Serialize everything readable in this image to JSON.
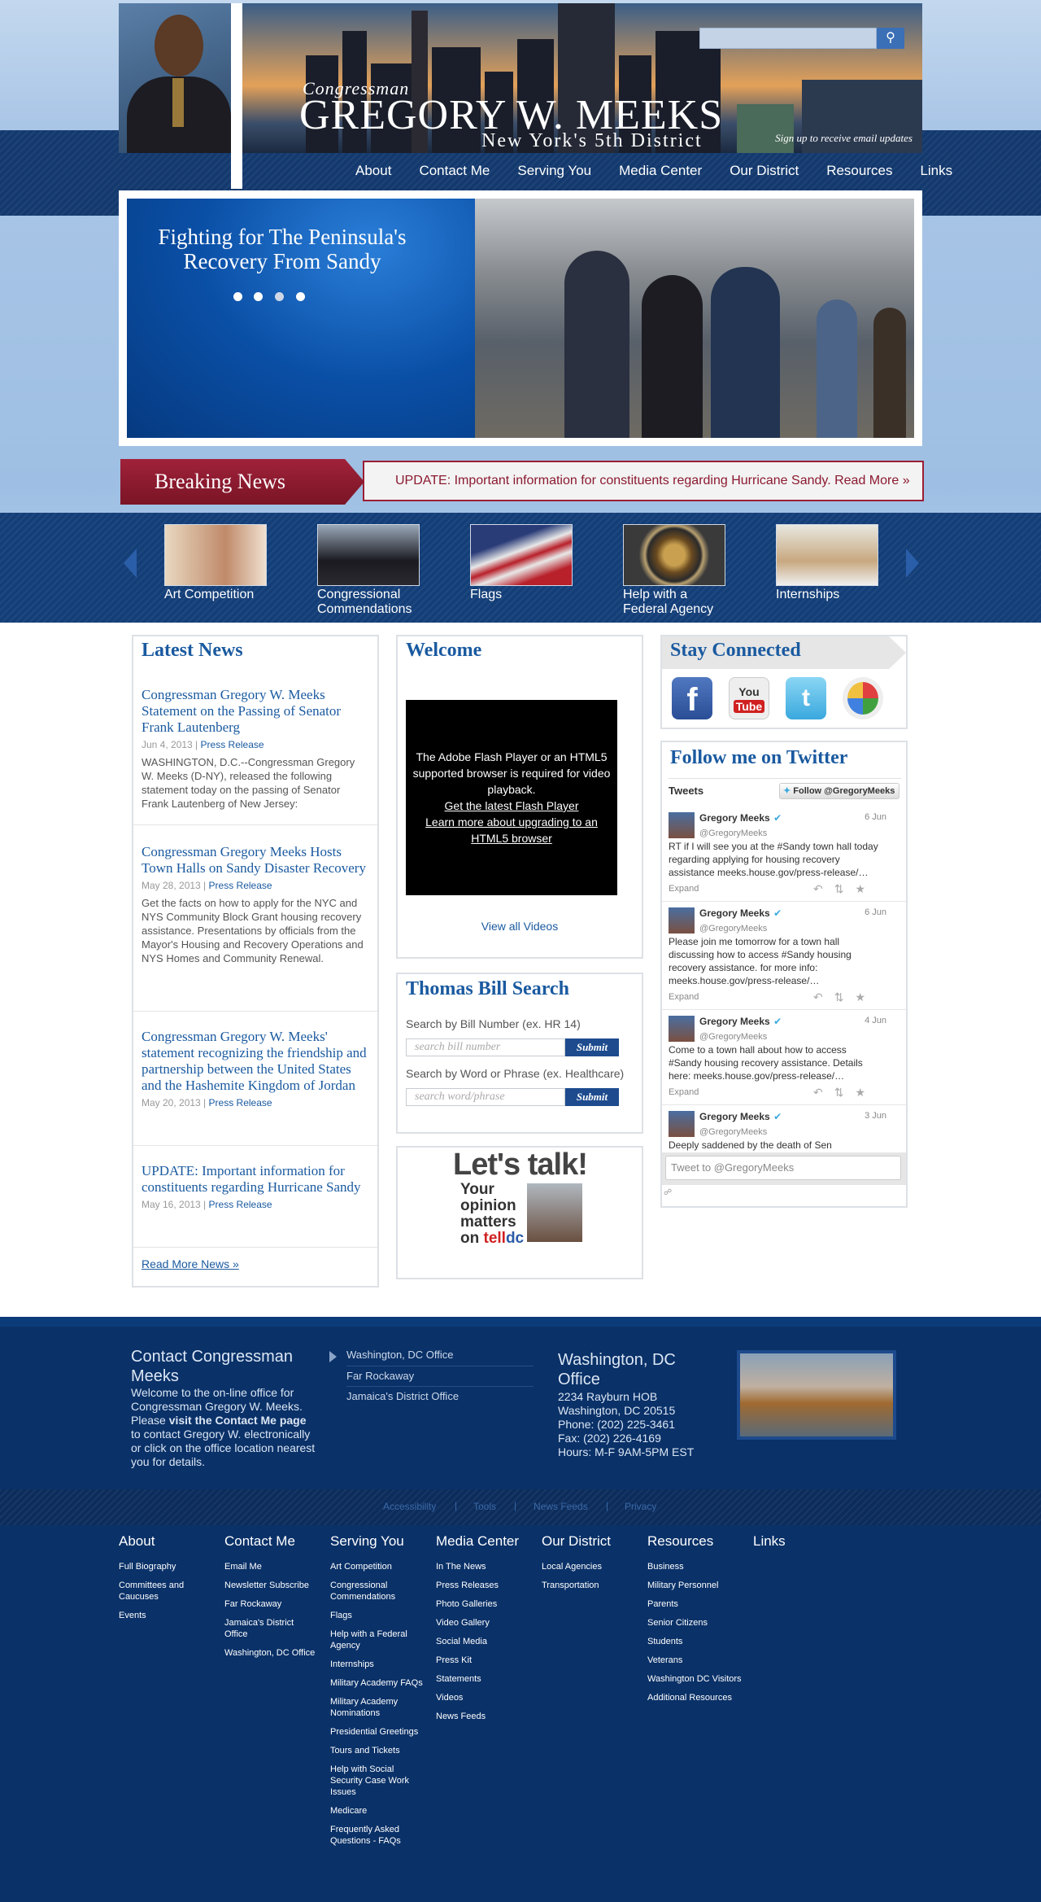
{
  "header": {
    "title_line1": "Congressman",
    "title_line2": "GREGORY W. MEEKS",
    "title_line3": "New York's 5th District",
    "search_placeholder": "",
    "signup": "Sign up to receive email updates"
  },
  "nav": [
    "About",
    "Contact Me",
    "Serving You",
    "Media Center",
    "Our District",
    "Resources",
    "Links"
  ],
  "slider": {
    "title": "Fighting for The Peninsula's Recovery From Sandy"
  },
  "breaking": {
    "label": "Breaking News",
    "text": "UPDATE: Important information for constituents regarding Hurricane Sandy. Read More »"
  },
  "carousel": [
    "Art Competition",
    "Congressional Commendations",
    "Flags",
    "Help with a Federal Agency",
    "Internships"
  ],
  "latest_news": {
    "title": "Latest News",
    "items": [
      {
        "title": "Congressman Gregory W. Meeks Statement on the Passing of Senator Frank Lautenberg",
        "date": "Jun 4, 2013",
        "type": "Press Release",
        "excerpt": "WASHINGTON, D.C.--Congressman Gregory W. Meeks (D-NY), released the following statement today on the passing of Senator Frank Lautenberg of New Jersey:"
      },
      {
        "title": "Congressman Gregory Meeks Hosts Town Halls on Sandy Disaster Recovery",
        "date": "May 28, 2013",
        "type": "Press Release",
        "excerpt": "Get the facts on how to apply for the NYC and NYS Community Block Grant housing recovery assistance. Presentations by officials from the Mayor's Housing and Recovery Operations and NYS Homes and Community Renewal."
      },
      {
        "title": "Congressman Gregory W. Meeks' statement recognizing the friendship and partnership between the United States and the Hashemite Kingdom of Jordan",
        "date": "May 20, 2013",
        "type": "Press Release",
        "excerpt": ""
      },
      {
        "title": "UPDATE: Important information for constituents regarding Hurricane Sandy",
        "date": "May 16, 2013",
        "type": "Press Release",
        "excerpt": ""
      }
    ],
    "more": "Read More News »"
  },
  "welcome": {
    "title": "Welcome",
    "flash_msg": "The Adobe Flash Player or an HTML5 supported browser is required for video playback.",
    "flash_link1": "Get the latest Flash Player",
    "flash_link2": "Learn more about upgrading to an HTML5 browser",
    "view_all": "View all Videos"
  },
  "thomas": {
    "title": "Thomas Bill Search",
    "label1": "Search by Bill Number (ex. HR 14)",
    "placeholder1": "search bill number",
    "label2": "Search by Word or Phrase (ex. Healthcare)",
    "placeholder2": "search word/phrase",
    "submit": "Submit"
  },
  "letstalk": {
    "title": "Let's talk!",
    "line1": "Your",
    "line2": "opinion",
    "line3": "matters",
    "line4a": "on ",
    "line4b": "tell",
    "line4c": "dc"
  },
  "stay_connected": {
    "title": "Stay Connected"
  },
  "twitter": {
    "title": "Follow me on Twitter",
    "tweets_label": "Tweets",
    "follow": "Follow @GregoryMeeks",
    "tweets": [
      {
        "name": "Gregory Meeks",
        "handle": "@GregoryMeeks",
        "date": "6 Jun",
        "text": "RT if I will see you at the #Sandy town hall today regarding applying for housing recovery assistance meeks.house.gov/press-release/…",
        "expand": "Expand"
      },
      {
        "name": "Gregory Meeks",
        "handle": "@GregoryMeeks",
        "date": "6 Jun",
        "text": "Please join me tomorrow for a town hall discussing how to access #Sandy housing recovery assistance. for more info: meeks.house.gov/press-release/…",
        "expand": "Expand"
      },
      {
        "name": "Gregory Meeks",
        "handle": "@GregoryMeeks",
        "date": "4 Jun",
        "text": "Come to a town hall about how to access #Sandy housing recovery assistance. Details here: meeks.house.gov/press-release/…",
        "expand": "Expand"
      },
      {
        "name": "Gregory Meeks",
        "handle": "@GregoryMeeks",
        "date": "3 Jun",
        "text": "Deeply saddened by the death of Sen",
        "expand": ""
      }
    ],
    "tweet_to": "Tweet to @GregoryMeeks"
  },
  "contact": {
    "title": "Contact Congressman Meeks",
    "text_a": "Welcome to the on-line office for Congressman Gregory W. Meeks. Please ",
    "text_b": "visit the Contact Me page",
    "text_c": " to contact Gregory W. electronically or click on the office location nearest you for details.",
    "offices": [
      "Washington, DC Office",
      "Far Rockaway",
      "Jamaica's District Office"
    ],
    "office_title": "Washington, DC Office",
    "address1": "2234 Rayburn HOB",
    "address2": "Washington, DC 20515",
    "phone": "Phone: (202) 225-3461",
    "fax": "Fax: (202) 226-4169",
    "hours": "Hours: M-F 9AM-5PM EST"
  },
  "utility": [
    "Accessibility",
    "Tools",
    "News Feeds",
    "Privacy"
  ],
  "sitemap": [
    {
      "head": "About",
      "items": [
        "Full Biography",
        "Committees and Caucuses",
        "Events"
      ]
    },
    {
      "head": "Contact Me",
      "items": [
        "Email Me",
        "Newsletter Subscribe",
        "Far Rockaway",
        "Jamaica's District Office",
        "Washington, DC Office"
      ]
    },
    {
      "head": "Serving You",
      "items": [
        "Art Competition",
        "Congressional Commendations",
        "Flags",
        "Help with a Federal Agency",
        "Internships",
        "Military Academy FAQs",
        "Military Academy Nominations",
        "Presidential Greetings",
        "Tours and Tickets",
        "Help with Social Security Case Work Issues",
        "Medicare",
        "Frequently Asked Questions - FAQs"
      ]
    },
    {
      "head": "Media Center",
      "items": [
        "In The News",
        "Press Releases",
        "Photo Galleries",
        "Video Gallery",
        "Social Media",
        "Press Kit",
        "Statements",
        "Videos",
        "News Feeds"
      ]
    },
    {
      "head": "Our District",
      "items": [
        "Local Agencies",
        "Transportation"
      ]
    },
    {
      "head": "Resources",
      "items": [
        "Business",
        "Military Personnel",
        "Parents",
        "Senior Citizens",
        "Students",
        "Veterans",
        "Washington DC Visitors",
        "Additional Resources"
      ]
    },
    {
      "head": "Links",
      "items": []
    }
  ]
}
